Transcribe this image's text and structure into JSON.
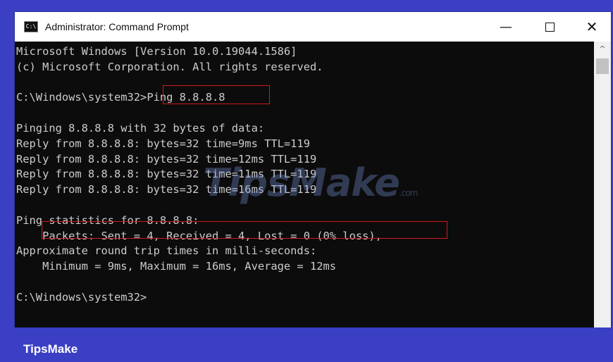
{
  "window": {
    "title": "Administrator: Command Prompt",
    "icon_label": "C:\\",
    "minimize_glyph": "—",
    "close_glyph": "✕"
  },
  "console": {
    "text": "Microsoft Windows [Version 10.0.19044.1586]\n(c) Microsoft Corporation. All rights reserved.\n\nC:\\Windows\\system32>Ping 8.8.8.8\n\nPinging 8.8.8.8 with 32 bytes of data:\nReply from 8.8.8.8: bytes=32 time=9ms TTL=119\nReply from 8.8.8.8: bytes=32 time=12ms TTL=119\nReply from 8.8.8.8: bytes=32 time=11ms TTL=119\nReply from 8.8.8.8: bytes=32 time=16ms TTL=119\n\nPing statistics for 8.8.8.8:\n    Packets: Sent = 4, Received = 4, Lost = 0 (0% loss),\nApproximate round trip times in milli-seconds:\n    Minimum = 9ms, Maximum = 16ms, Average = 12ms\n\nC:\\Windows\\system32>"
  },
  "scrollbar": {
    "up_glyph": "^"
  },
  "watermark": {
    "text": "TipsMake",
    "suffix": ".com"
  },
  "footer": {
    "brand": "TipsMake"
  },
  "colors": {
    "background": "#3a3fc4",
    "highlight": "#d01a1a",
    "console_text": "#cccccc"
  }
}
